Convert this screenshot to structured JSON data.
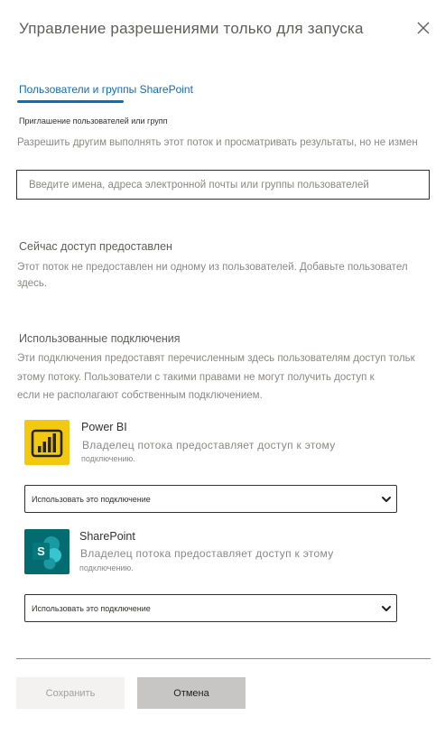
{
  "panel": {
    "title": "Управление разрешениями только для запуска"
  },
  "tabs": [
    {
      "label": "Пользователи и группы SharePoint",
      "active": true
    }
  ],
  "invite": {
    "label": "Приглашение пользователей или групп",
    "description": "Разрешить другим выполнять этот поток и просматривать результаты, но не измен",
    "placeholder": "Введите имена, адреса электронной почты или группы пользователей"
  },
  "access": {
    "heading": "Сейчас доступ предоставлен",
    "line1": "Этот поток не предоставлен ни одному из пользователей. Добавьте пользовател",
    "line2": "здесь."
  },
  "connections": {
    "heading": "Использованные подключения",
    "desc_line1": "Эти подключения предоставят перечисленным здесь пользователям доступ тольк",
    "desc_line2": "этому потоку. Пользователи с такими правами не могут получить доступ к",
    "desc_line3": "если не располагают собственным подключением.",
    "items": [
      {
        "name": "Power BI",
        "desc_line1": "Владелец потока предоставляет доступ к этому",
        "desc_line2": "подключению.",
        "select_value": "Использовать это подключение",
        "icon": "power-bi-icon",
        "color": "#f2c811"
      },
      {
        "name": "SharePoint",
        "desc_line1": "Владелец потока предоставляет доступ к этому",
        "desc_line2": "подключению.",
        "select_value": "Использовать это подключение",
        "icon": "sharepoint-icon",
        "color": "#036c70"
      }
    ]
  },
  "footer": {
    "save_label": "Сохранить",
    "cancel_label": "Отмена"
  }
}
